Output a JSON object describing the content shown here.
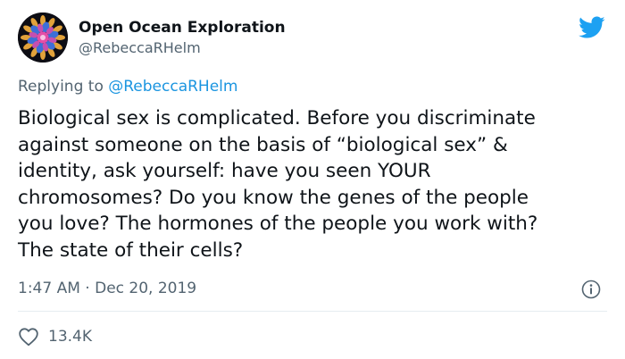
{
  "author": {
    "display_name": "Open Ocean Exploration",
    "handle": "@RebeccaRHelm",
    "avatar_icon": "jellyfish-avatar"
  },
  "reply": {
    "prefix": "Replying to",
    "mention": "@RebeccaRHelm"
  },
  "tweet": {
    "lines": [
      "Biological sex is complicated. Before you discriminate",
      "against someone on the basis of “biological sex” &",
      "identity, ask yourself: have you seen YOUR",
      "chromosomes? Do you know the genes of the people",
      "you love? The hormones of the people you work with?",
      "The state of their cells?"
    ]
  },
  "meta": {
    "time": "1:47 AM",
    "separator": " · ",
    "date": "Dec 20, 2019"
  },
  "stats": {
    "likes": "13.4K"
  },
  "colors": {
    "brand_blue": "#1da1f2",
    "link_blue": "#1b95e0",
    "secondary_text": "#536471",
    "primary_text": "#0f1419"
  },
  "icons": {
    "logo": "twitter-bird-icon",
    "info": "info-icon",
    "like": "heart-icon"
  }
}
